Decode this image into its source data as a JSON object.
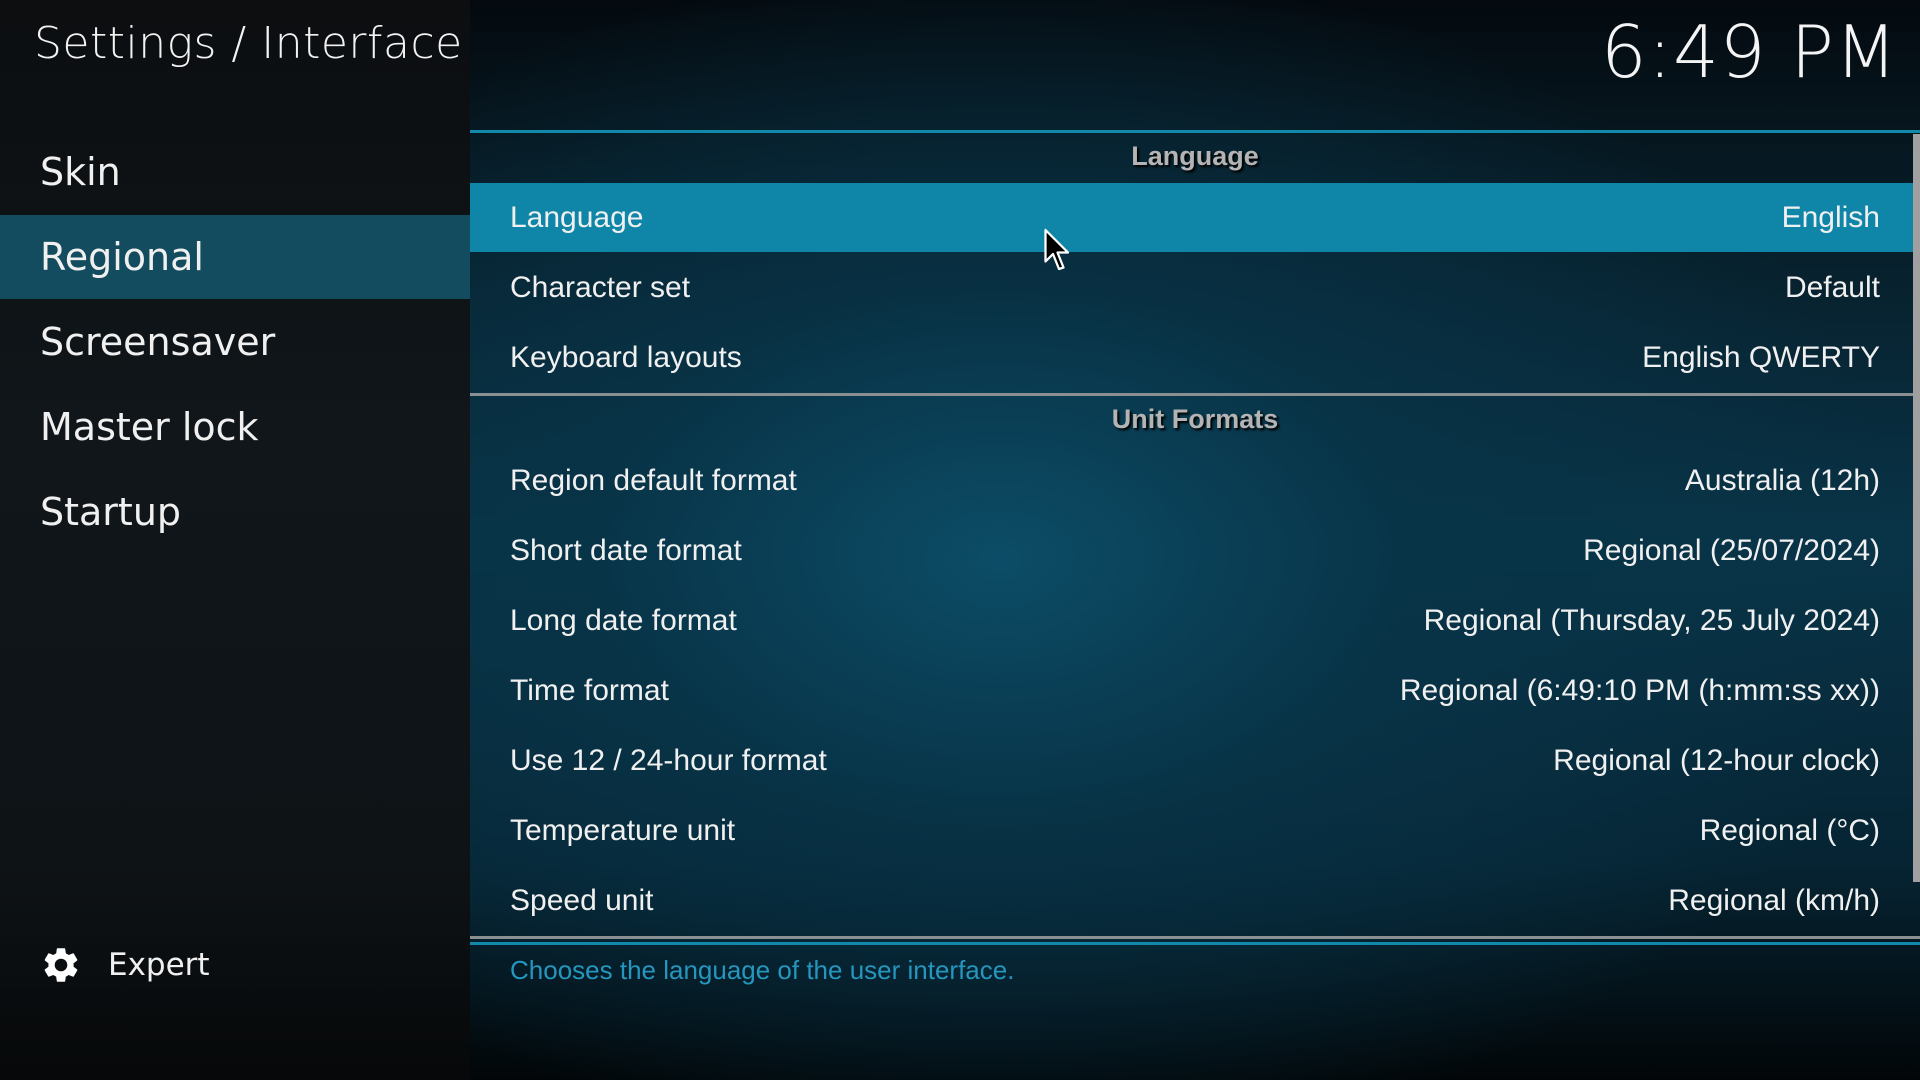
{
  "header": {
    "title": "Settings / Interface",
    "clock": "6:49 PM"
  },
  "sidebar": {
    "items": [
      {
        "label": "Skin",
        "active": false
      },
      {
        "label": "Regional",
        "active": true
      },
      {
        "label": "Screensaver",
        "active": false
      },
      {
        "label": "Master lock",
        "active": false
      },
      {
        "label": "Startup",
        "active": false
      }
    ],
    "expert": {
      "label": "Expert",
      "icon": "gear-icon"
    }
  },
  "sections": [
    {
      "title": "Language",
      "settings": [
        {
          "label": "Language",
          "value": "English",
          "selected": true
        },
        {
          "label": "Character set",
          "value": "Default"
        },
        {
          "label": "Keyboard layouts",
          "value": "English QWERTY"
        }
      ]
    },
    {
      "title": "Unit Formats",
      "settings": [
        {
          "label": "Region default format",
          "value": "Australia (12h)"
        },
        {
          "label": "Short date format",
          "value": "Regional (25/07/2024)"
        },
        {
          "label": "Long date format",
          "value": "Regional (Thursday, 25 July 2024)"
        },
        {
          "label": "Time format",
          "value": "Regional (6:49:10 PM (h:mm:ss xx))"
        },
        {
          "label": "Use 12 / 24-hour format",
          "value": "Regional (12-hour clock)"
        },
        {
          "label": "Temperature unit",
          "value": "Regional (°C)"
        },
        {
          "label": "Speed unit",
          "value": "Regional (km/h)"
        }
      ]
    }
  ],
  "description": "Chooses the language of the user interface.",
  "colors": {
    "accent": "#0f86a8",
    "sidebar_active": "#134c5e",
    "description_text": "#2596be"
  }
}
